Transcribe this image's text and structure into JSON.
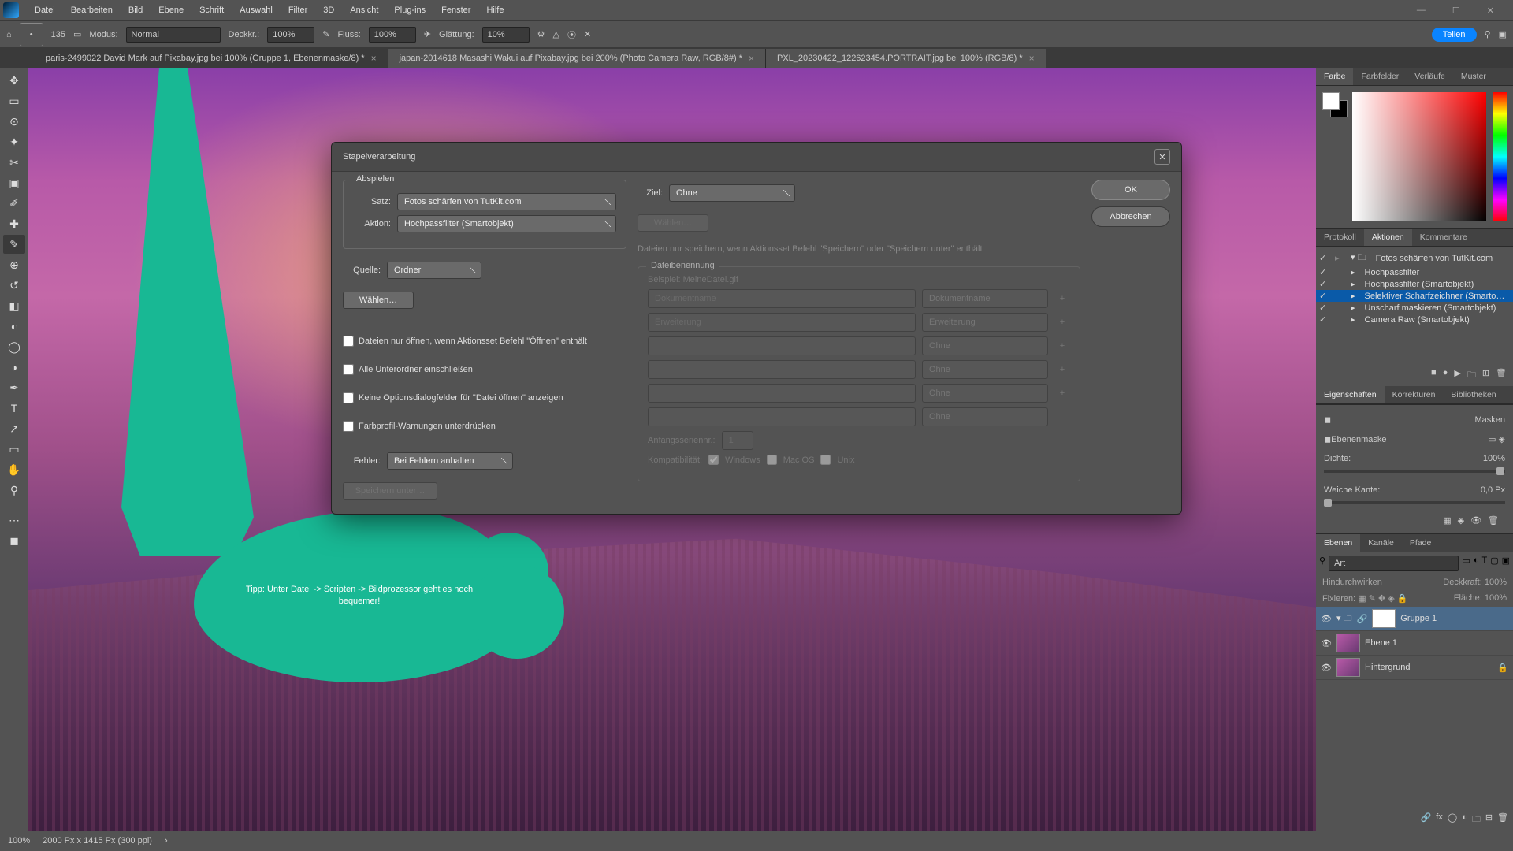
{
  "menu": [
    "Datei",
    "Bearbeiten",
    "Bild",
    "Ebene",
    "Schrift",
    "Auswahl",
    "Filter",
    "3D",
    "Ansicht",
    "Plug-ins",
    "Fenster",
    "Hilfe"
  ],
  "optbar": {
    "brush_size": "135",
    "modus_label": "Modus:",
    "modus": "Normal",
    "deckkr_label": "Deckkr.:",
    "deckkr": "100%",
    "fluss_label": "Fluss:",
    "fluss": "100%",
    "glattung_label": "Glättung:",
    "glattung": "10%",
    "share": "Teilen"
  },
  "tabs": [
    "paris-2499022 David Mark auf Pixabay.jpg bei 100% (Gruppe 1, Ebenenmaske/8) *",
    "japan-2014618 Masashi Wakui auf Pixabay.jpg bei 200% (Photo Camera Raw, RGB/8#) *",
    "PXL_20230422_122623454.PORTRAIT.jpg bei 100% (RGB/8) *"
  ],
  "tip": "Tipp: Unter Datei -> Scripten -> Bildprozessor geht es noch bequemer!",
  "dialog": {
    "title": "Stapelverarbeitung",
    "abspielen": "Abspielen",
    "satz_label": "Satz:",
    "satz": "Fotos schärfen von TutKit.com",
    "aktion_label": "Aktion:",
    "aktion": "Hochpassfilter (Smartobjekt)",
    "quelle_label": "Quelle:",
    "quelle": "Ordner",
    "wahlen": "Wählen…",
    "chk1": "Dateien nur öffnen, wenn Aktionsset Befehl \"Öffnen\" enthält",
    "chk2": "Alle Unterordner einschließen",
    "chk3": "Keine Optionsdialogfelder für \"Datei öffnen\" anzeigen",
    "chk4": "Farbprofil-Warnungen unterdrücken",
    "fehler_label": "Fehler:",
    "fehler": "Bei Fehlern anhalten",
    "speichern": "Speichern unter…",
    "ziel_label": "Ziel:",
    "ziel": "Ohne",
    "save_hint": "Dateien nur speichern, wenn Aktionsset Befehl \"Speichern\" oder \"Speichern unter\" enthält",
    "dateiben": "Dateibenennung",
    "beispiel": "Beispiel: MeineDatei.gif",
    "name1": "Dokumentname",
    "name1v": "Dokumentname",
    "name2": "Erweiterung",
    "name2v": "Erweiterung",
    "ohne": "Ohne",
    "anfang": "Anfangsseriennr.:",
    "anfang_v": "1",
    "kompat": "Kompatibilität:",
    "win": "Windows",
    "mac": "Mac OS",
    "unix": "Unix",
    "ok": "OK",
    "cancel": "Abbrechen"
  },
  "color_tabs": [
    "Farbe",
    "Farbfelder",
    "Verläufe",
    "Muster"
  ],
  "act_tabs": [
    "Protokoll",
    "Aktionen",
    "Kommentare"
  ],
  "actions": [
    {
      "name": "Fotos schärfen von TutKit.com",
      "folder": true
    },
    {
      "name": "Hochpassfilter"
    },
    {
      "name": "Hochpassfilter (Smartobjekt)"
    },
    {
      "name": "Selektiver Scharfzeichner (Smarto…",
      "sel": true
    },
    {
      "name": "Unscharf maskieren (Smartobjekt)"
    },
    {
      "name": "Camera Raw (Smartobjekt)"
    }
  ],
  "prop_tabs": [
    "Eigenschaften",
    "Korrekturen",
    "Bibliotheken"
  ],
  "props": {
    "masken": "Masken",
    "ebenenmaske": "Ebenenmaske",
    "dichte_label": "Dichte:",
    "dichte": "100%",
    "kante_label": "Weiche Kante:",
    "kante": "0,0 Px"
  },
  "layer_tabs": [
    "Ebenen",
    "Kanäle",
    "Pfade"
  ],
  "layer_search": "Art",
  "layer_top": {
    "mode": "Hindurchwirken",
    "deck_label": "Deckkraft:",
    "deck": "100%",
    "fix_label": "Fixieren:",
    "flache_label": "Fläche:",
    "flache": "100%"
  },
  "layers": [
    {
      "name": "Gruppe 1",
      "group": true,
      "sel": true
    },
    {
      "name": "Ebene 1"
    },
    {
      "name": "Hintergrund",
      "locked": true
    }
  ],
  "status": {
    "zoom": "100%",
    "doc": "2000 Px x 1415 Px (300 ppi)"
  }
}
